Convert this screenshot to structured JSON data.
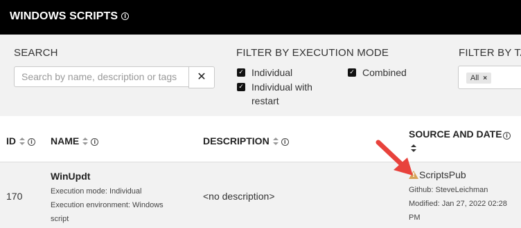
{
  "header": {
    "title": "WINDOWS SCRIPTS"
  },
  "filters": {
    "search": {
      "label": "SEARCH",
      "placeholder": "Search by name, description or tags",
      "value": ""
    },
    "execution_mode": {
      "label": "FILTER BY EXECUTION MODE",
      "options": [
        {
          "label": "Individual",
          "checked": true
        },
        {
          "label": "Individual with",
          "label2": "restart",
          "checked": true
        },
        {
          "label": "Combined",
          "checked": true
        }
      ]
    },
    "tags": {
      "label": "FILTER BY TA",
      "selected": [
        "All"
      ]
    }
  },
  "table": {
    "columns": [
      {
        "label": "ID"
      },
      {
        "label": "NAME"
      },
      {
        "label": "DESCRIPTION"
      },
      {
        "label": "SOURCE AND DATE"
      }
    ],
    "rows": [
      {
        "id": "170",
        "name": "WinUpdt",
        "exec_mode": "Execution mode: Individual",
        "exec_env_1": "Execution environment: Windows",
        "exec_env_2": "script",
        "description": "<no description>",
        "source": "ScriptsPub",
        "github": "Github: SteveLeichman",
        "modified_1": "Modified: Jan 27, 2022 02:28",
        "modified_2": "PM"
      }
    ]
  },
  "colors": {
    "warning": "#d6a257",
    "arrow": "#e8423c",
    "topbar": "#000000",
    "panel": "#f2f2f2"
  }
}
